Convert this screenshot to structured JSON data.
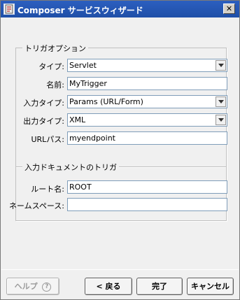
{
  "window": {
    "title": "Composer サービスウィザード",
    "close_glyph": "✕"
  },
  "trigger_group": {
    "legend": "トリガオプション",
    "type_label": "タイプ:",
    "type_value": "Servlet",
    "name_label": "名前:",
    "name_value": "MyTrigger",
    "input_type_label": "入力タイプ:",
    "input_type_value": "Params (URL/Form)",
    "output_type_label": "出力タイプ:",
    "output_type_value": "XML",
    "url_path_label": "URLパス:",
    "url_path_value": "myendpoint"
  },
  "input_doc_group": {
    "legend": "入力ドキュメントのトリガ",
    "root_name_label": "ルート名:",
    "root_name_value": "ROOT",
    "namespace_label": "ネームスペース:",
    "namespace_value": ""
  },
  "buttons": {
    "help_label": "ヘルプ",
    "help_glyph": "?",
    "back_label": "< 戻る",
    "finish_label": "完了",
    "cancel_label": "キャンセル"
  },
  "colors": {
    "title_bar": "#1f4fa8",
    "input_border": "#7f9db9"
  }
}
